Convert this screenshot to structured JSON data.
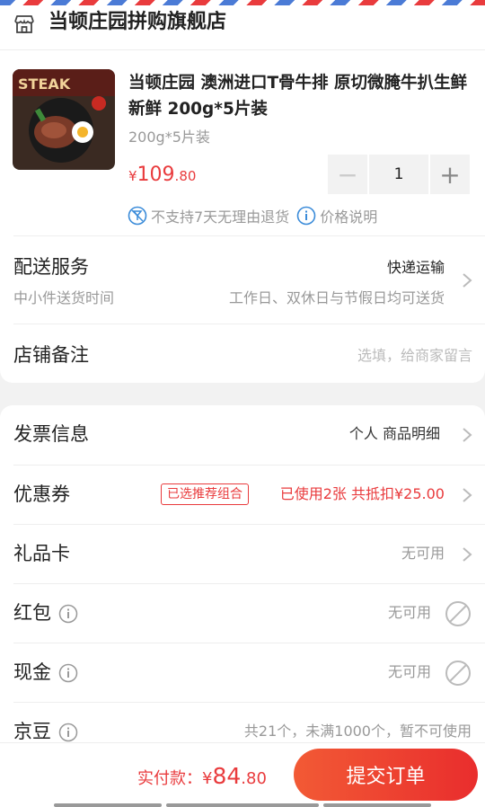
{
  "shop": {
    "name": "当顿庄园拼购旗舰店",
    "icon": "store-icon"
  },
  "product": {
    "title": "当顿庄园 澳洲进口T骨牛排 原切微腌牛扒生鲜新鲜 200g*5片装",
    "spec": "200g*5片装",
    "price_currency": "¥",
    "price_int": "109",
    "price_dec": ".80",
    "quantity": "1",
    "minus": "−",
    "plus": "+",
    "image_label": "STEAK"
  },
  "notices": {
    "no_return": "不支持7天无理由退货",
    "price_info": "价格说明"
  },
  "delivery": {
    "label": "配送服务",
    "method": "快递运输",
    "sub_label": "中小件送货时间",
    "sub_value": "工作日、双休日与节假日均可送货"
  },
  "remark": {
    "label": "店铺备注",
    "placeholder": "选填，给商家留言"
  },
  "invoice": {
    "label": "发票信息",
    "value": "个人 商品明细"
  },
  "coupon": {
    "label": "优惠券",
    "tag": "已选推荐组合",
    "value": "已使用2张 共抵扣¥25.00"
  },
  "gift_card": {
    "label": "礼品卡",
    "value": "无可用"
  },
  "red_packet": {
    "label": "红包",
    "value": "无可用"
  },
  "cash": {
    "label": "现金",
    "value": "无可用"
  },
  "jingdou": {
    "label": "京豆",
    "value": "共21个，未满1000个，暂不可使用"
  },
  "bottom": {
    "pay_label": "实付款：",
    "currency": "¥",
    "amount_int": "84",
    "amount_dec": ".80",
    "submit": "提交订单"
  },
  "colors": {
    "accent": "#e93b3d",
    "muted": "#999999",
    "info_blue": "#3a8bd9"
  }
}
